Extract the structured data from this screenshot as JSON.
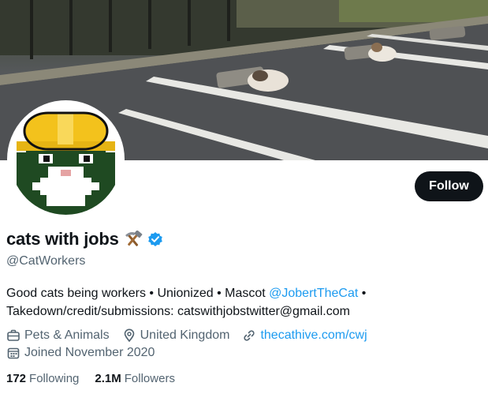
{
  "profile": {
    "display_name": "cats with jobs",
    "handle": "@CatWorkers",
    "name_emoji_icon": "hammer-and-pick-icon",
    "verified_icon": "verified-badge-icon"
  },
  "actions": {
    "follow_label": "Follow"
  },
  "bio": {
    "line1_prefix": "Good cats being workers • Unionized • Mascot ",
    "line1_link": "@JobertTheCat",
    "line1_suffix": " •",
    "line2": "Takedown/credit/submissions: catswithjobstwitter@gmail.com"
  },
  "meta": {
    "category": "Pets & Animals",
    "location": "United Kingdom",
    "website": "thecathive.com/cwj",
    "joined": "Joined November 2020"
  },
  "stats": {
    "following_count": "172",
    "following_label": "Following",
    "followers_count": "2.1M",
    "followers_label": "Followers"
  },
  "colors": {
    "accent": "#1d9bf0",
    "text": "#0f1419",
    "muted": "#536471",
    "button": "#0f1419"
  }
}
